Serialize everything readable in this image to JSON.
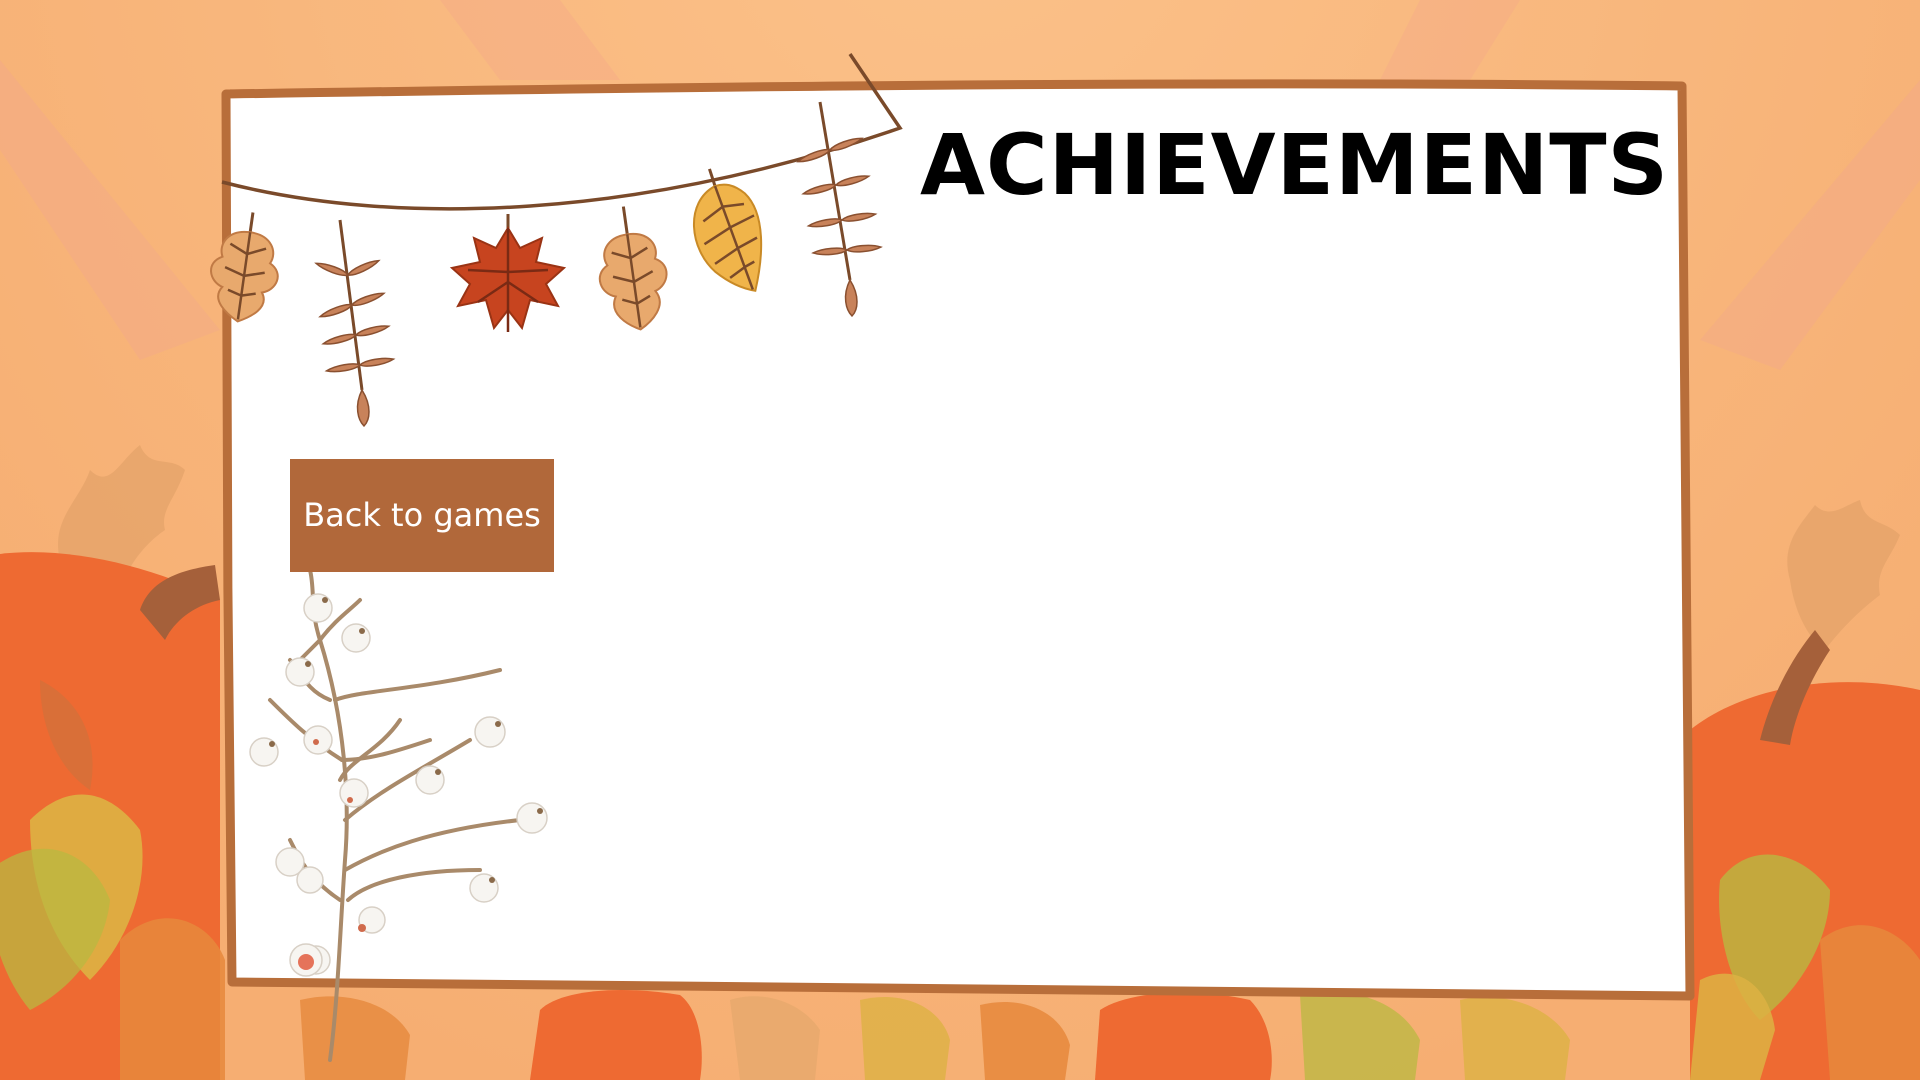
{
  "screen": {
    "title": "ACHIEVEMENTS",
    "back_button": {
      "label": "Back to games"
    }
  },
  "colors": {
    "sky": "#f8b97f",
    "panel_fill": "#ffffff",
    "panel_border": "#b86e3a",
    "button_fill": "#b1683a",
    "button_text": "#ffffff",
    "title_text": "#000000",
    "pumpkin": "#ee6a32",
    "leaf_orange": "#e6883c",
    "leaf_yellow": "#ddb243",
    "leaf_green": "#b9b840",
    "leaf_brown": "#c88156",
    "garland_string": "#7a4a2a",
    "maple_red": "#c7441f",
    "berry_white": "#f7f5f1",
    "branch": "#a98a6a"
  },
  "decor": {
    "background": [
      "sun-rays",
      "pumpkin",
      "oak-leaf",
      "fall-leaves"
    ],
    "garland": [
      "oak-leaf",
      "fern-leaf",
      "maple-leaf",
      "oak-leaf",
      "birch-leaf",
      "fern-leaf"
    ],
    "branch": "white-berry-branch"
  }
}
